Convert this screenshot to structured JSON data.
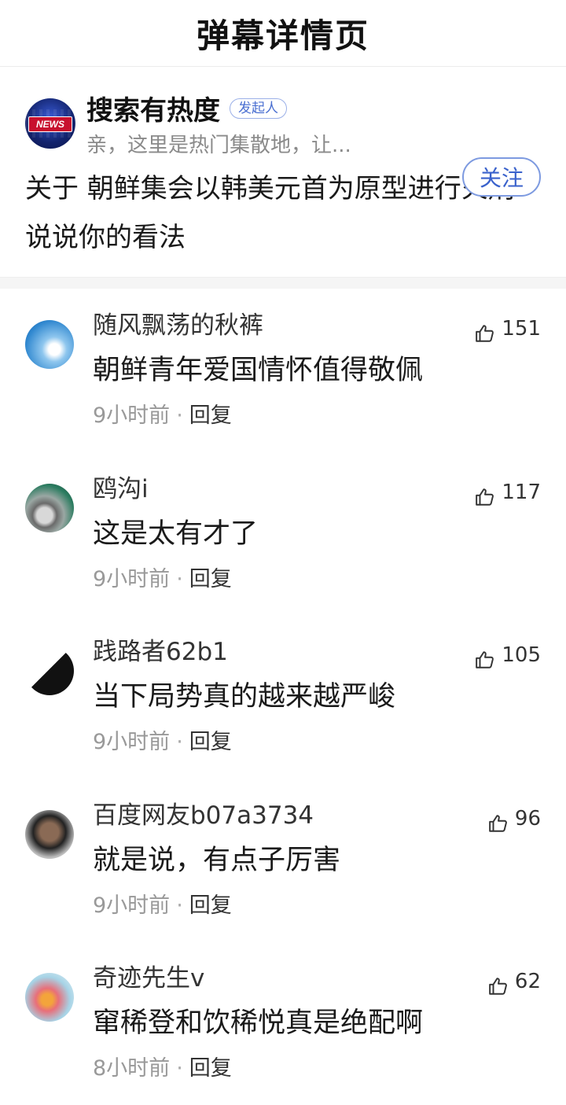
{
  "header": {
    "title": "弹幕详情页"
  },
  "poster": {
    "avatar_logo": "NEWS",
    "name": "搜索有热度",
    "badge": "发起人",
    "description": "亲，这里是热门集散地，让...",
    "follow_label": "关注",
    "topic": "关于 朝鲜集会以韩美元首为原型进行火刑 说说你的看法"
  },
  "comments": [
    {
      "user": "随风飘荡的秋裤",
      "text": "朝鲜青年爱国情怀值得敬佩",
      "time": "9小时前",
      "dot": "·",
      "reply": "回复",
      "likes": "151"
    },
    {
      "user": "鸥沟i",
      "text": "这是太有才了",
      "time": "9小时前",
      "dot": "·",
      "reply": "回复",
      "likes": "117"
    },
    {
      "user": "践路者62b1",
      "text": "当下局势真的越来越严峻",
      "time": "9小时前",
      "dot": "·",
      "reply": "回复",
      "likes": "105"
    },
    {
      "user": "百度网友b07a3734",
      "text": "就是说，有点子厉害",
      "time": "9小时前",
      "dot": "·",
      "reply": "回复",
      "likes": "96"
    },
    {
      "user": "奇迹先生v",
      "text": "窜稀登和饮稀悦真是绝配啊",
      "time": "8小时前",
      "dot": "·",
      "reply": "回复",
      "likes": "62"
    }
  ],
  "icons": {
    "like": "thumbs-up-icon"
  },
  "colors": {
    "accent": "#3a62cc",
    "muted": "#999999"
  }
}
